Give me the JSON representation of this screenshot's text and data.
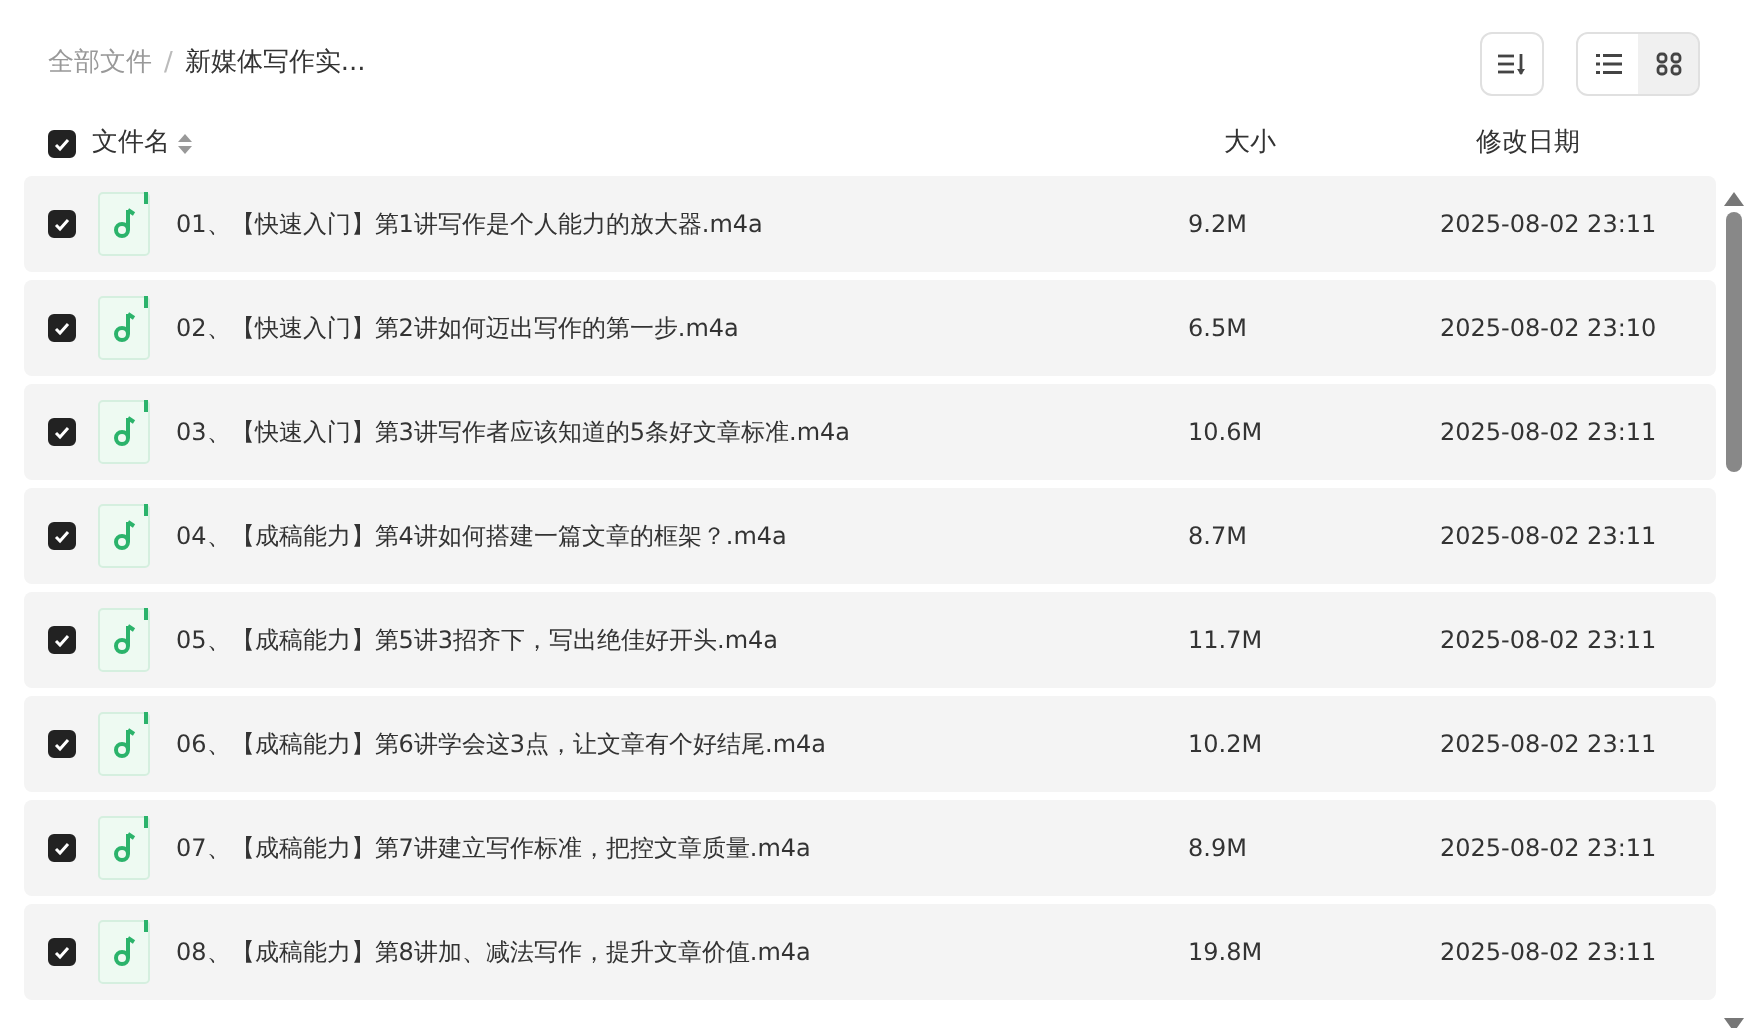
{
  "breadcrumb_separator": "/",
  "breadcrumb": [
    {
      "label": "全部文件",
      "current": false
    },
    {
      "label": "新媒体写作实...",
      "current": true
    }
  ],
  "view_modes": [
    {
      "kind": "list",
      "selected": true
    },
    {
      "kind": "grid",
      "selected": false
    }
  ],
  "table": {
    "select_all_checked": true,
    "columns": [
      "文件名",
      "大小",
      "修改日期"
    ],
    "rows": [
      {
        "checked": true,
        "name": "01、【快速入门】第1讲写作是个人能力的放大器.m4a",
        "size": "9.2M",
        "date": "2025-08-02 23:11"
      },
      {
        "checked": true,
        "name": "02、【快速入门】第2讲如何迈出写作的第一步.m4a",
        "size": "6.5M",
        "date": "2025-08-02 23:10"
      },
      {
        "checked": true,
        "name": "03、【快速入门】第3讲写作者应该知道的5条好文章标准.m4a",
        "size": "10.6M",
        "date": "2025-08-02 23:11"
      },
      {
        "checked": true,
        "name": "04、【成稿能力】第4讲如何搭建一篇文章的框架？.m4a",
        "size": "8.7M",
        "date": "2025-08-02 23:11"
      },
      {
        "checked": true,
        "name": "05、【成稿能力】第5讲3招齐下，写出绝佳好开头.m4a",
        "size": "11.7M",
        "date": "2025-08-02 23:11"
      },
      {
        "checked": true,
        "name": "06、【成稿能力】第6讲学会这3点，让文章有个好结尾.m4a",
        "size": "10.2M",
        "date": "2025-08-02 23:11"
      },
      {
        "checked": true,
        "name": "07、【成稿能力】第7讲建立写作标准，把控文章质量.m4a",
        "size": "8.9M",
        "date": "2025-08-02 23:11"
      },
      {
        "checked": true,
        "name": "08、【成稿能力】第8讲加、减法写作，提升文章价值.m4a",
        "size": "19.8M",
        "date": "2025-08-02 23:11"
      }
    ]
  }
}
